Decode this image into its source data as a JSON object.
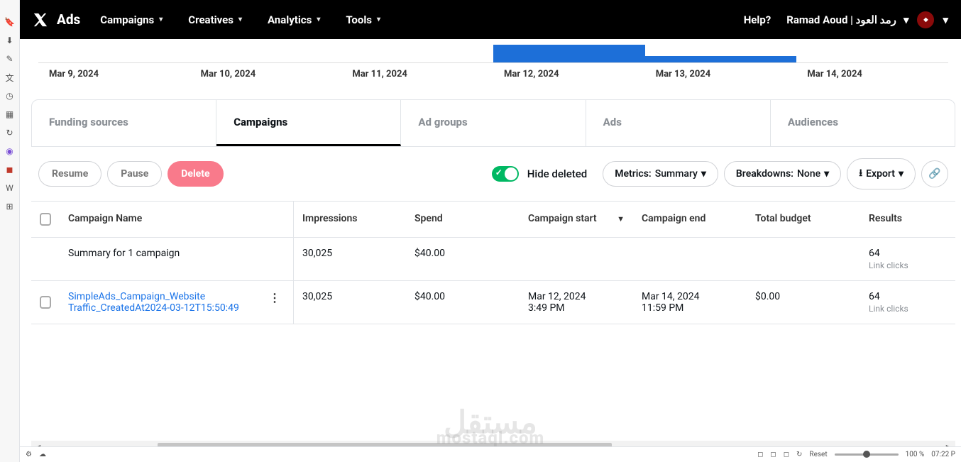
{
  "nav": {
    "brand": "Ads",
    "items": [
      "Campaigns",
      "Creatives",
      "Analytics",
      "Tools"
    ],
    "help": "Help?",
    "account": "Ramad Aoud | رمد العود"
  },
  "chart_data": {
    "type": "bar",
    "categories": [
      "Mar 9, 2024",
      "Mar 10, 2024",
      "Mar 11, 2024",
      "Mar 12, 2024",
      "Mar 13, 2024",
      "Mar 14, 2024"
    ],
    "values": [
      0,
      0,
      0,
      22000,
      8000,
      25
    ],
    "ylim": [
      0,
      25000
    ]
  },
  "tabs": [
    "Funding sources",
    "Campaigns",
    "Ad groups",
    "Ads",
    "Audiences"
  ],
  "active_tab": 1,
  "toolbar": {
    "resume": "Resume",
    "pause": "Pause",
    "delete": "Delete",
    "hide_deleted": "Hide deleted",
    "metrics_label": "Metrics:",
    "metrics_value": "Summary",
    "breakdowns_label": "Breakdowns:",
    "breakdowns_value": "None",
    "export": "Export"
  },
  "columns": {
    "name": "Campaign Name",
    "impressions": "Impressions",
    "spend": "Spend",
    "start": "Campaign start",
    "end": "Campaign end",
    "budget": "Total budget",
    "results": "Results"
  },
  "summary": {
    "label": "Summary for 1 campaign",
    "impressions": "30,025",
    "spend": "$40.00",
    "results": "64",
    "results_sub": "Link clicks"
  },
  "rows": [
    {
      "name": "SimpleAds_Campaign_Website Traffic_CreatedAt2024-03-12T15:50:49",
      "impressions": "30,025",
      "spend": "$40.00",
      "start_date": "Mar 12, 2024",
      "start_time": "3:49 PM",
      "end_date": "Mar 14, 2024",
      "end_time": "11:59 PM",
      "budget": "$0.00",
      "results": "64",
      "results_sub": "Link clicks"
    }
  ],
  "watermark": "مستقل",
  "watermark2": "mostaql.com",
  "status": {
    "reset": "Reset",
    "zoom": "100 %",
    "time": "07:22 P"
  }
}
